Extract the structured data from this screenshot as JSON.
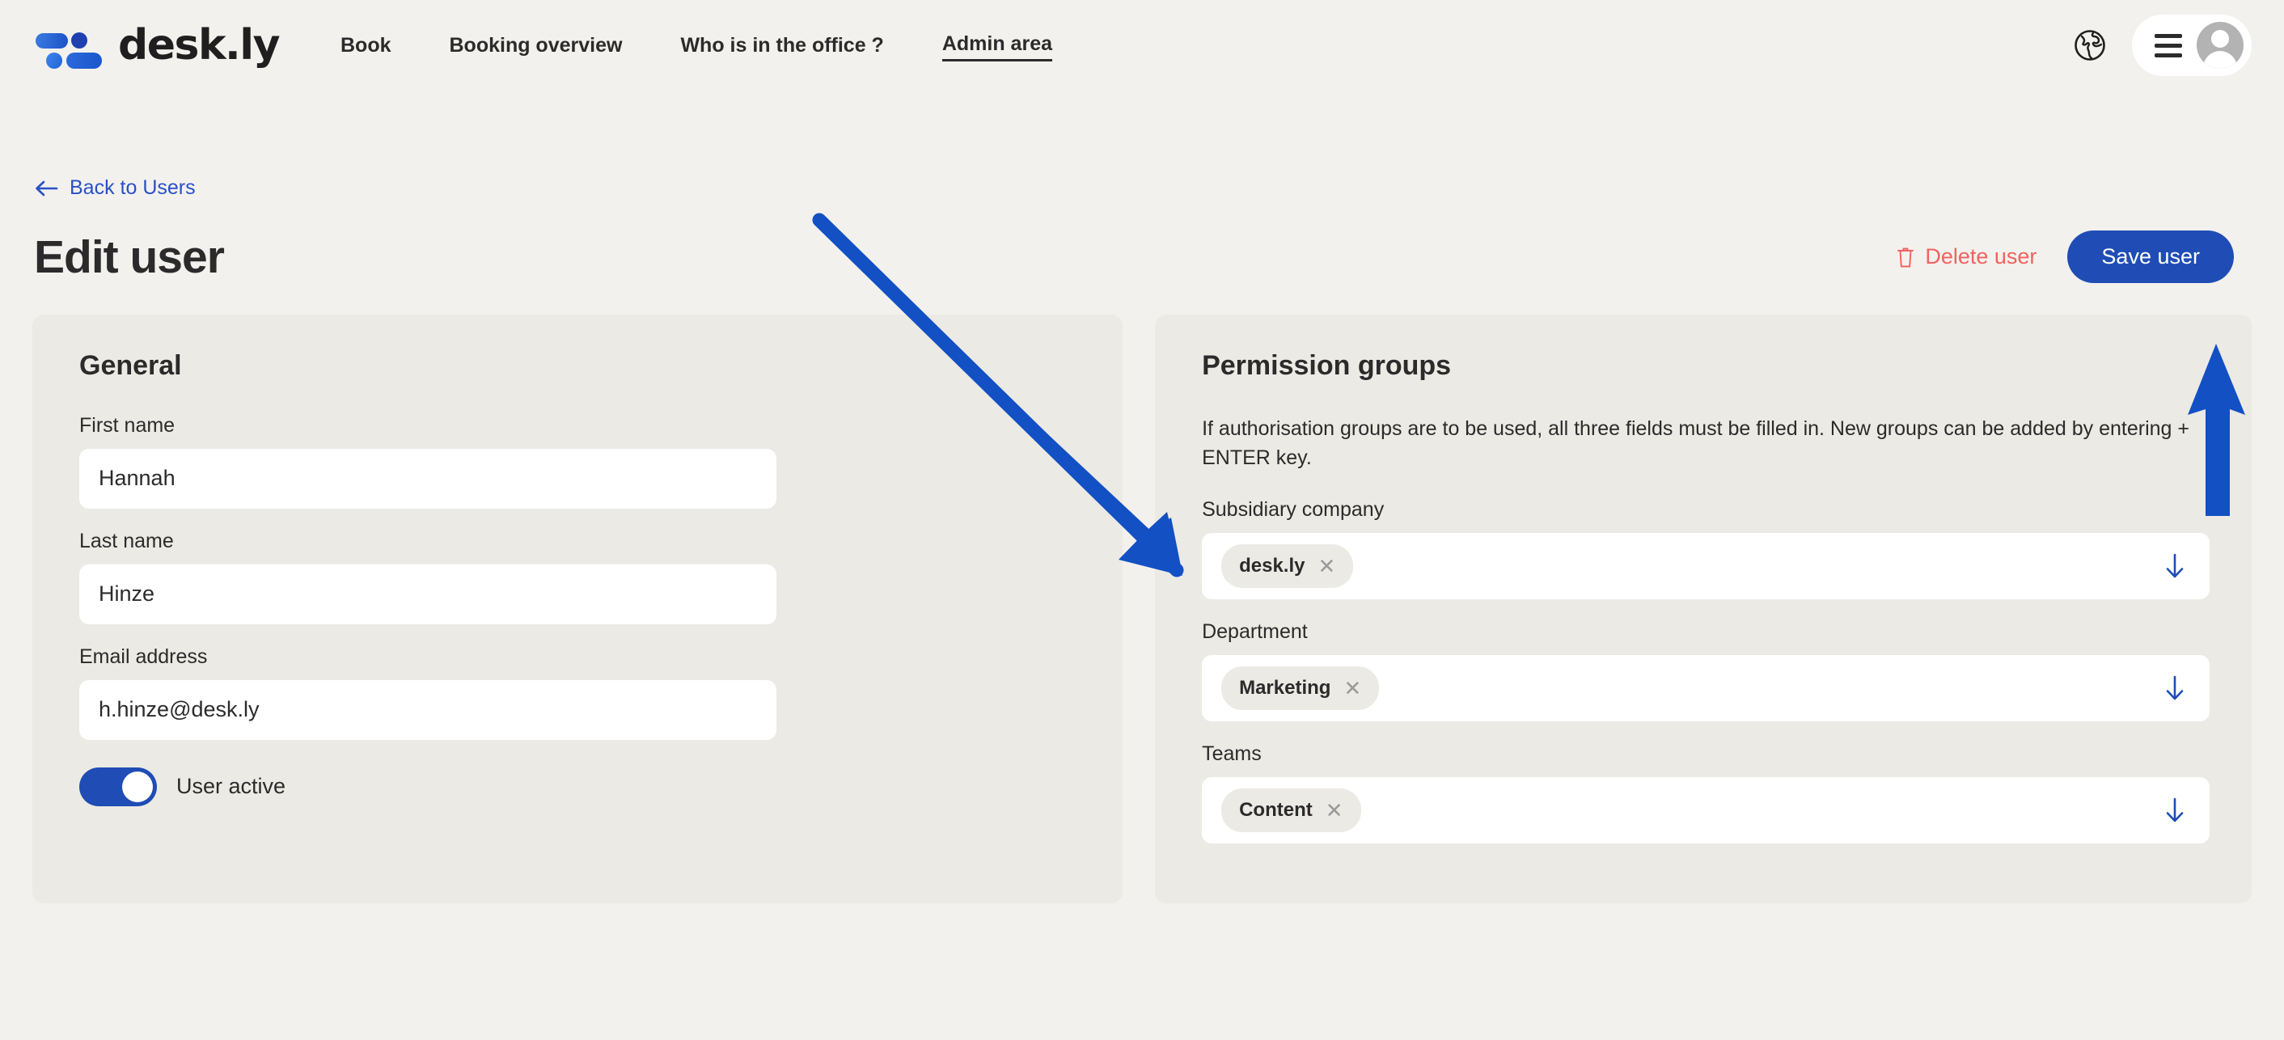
{
  "brand": {
    "name": "desk.ly",
    "logo_icon": "deskly-dots-logo"
  },
  "nav": {
    "items": [
      {
        "label": "Book",
        "active": false
      },
      {
        "label": "Booking overview",
        "active": false
      },
      {
        "label": "Who is in the office ?",
        "active": false
      },
      {
        "label": "Admin area",
        "active": true
      }
    ],
    "language_icon": "globe-icon",
    "menu_icon": "hamburger-menu-icon",
    "avatar_icon": "user-avatar-icon"
  },
  "back_link": {
    "label": "Back to Users",
    "icon": "arrow-left-icon"
  },
  "header": {
    "title": "Edit user",
    "delete_label": "Delete user",
    "delete_icon": "trash-icon",
    "save_label": "Save user"
  },
  "general": {
    "title": "General",
    "fields": [
      {
        "label": "First name",
        "value": "Hannah"
      },
      {
        "label": "Last name",
        "value": "Hinze"
      },
      {
        "label": "Email address",
        "value": "h.hinze@desk.ly"
      }
    ],
    "toggle": {
      "label": "User active",
      "on": true
    }
  },
  "permissions": {
    "title": "Permission groups",
    "description": "If authorisation groups are to be used, all three fields must be filled in. New groups can be added by entering + ENTER key.",
    "fields": [
      {
        "label": "Subsidiary company",
        "chip": "desk.ly",
        "remove_icon": "close-icon",
        "arrow_icon": "arrow-down-icon"
      },
      {
        "label": "Department",
        "chip": "Marketing",
        "remove_icon": "close-icon",
        "arrow_icon": "arrow-down-icon"
      },
      {
        "label": "Teams",
        "chip": "Content",
        "remove_icon": "close-icon",
        "arrow_icon": "arrow-down-icon"
      }
    ]
  },
  "annotations": {
    "arrow_diagonal": "points to Permission groups Subsidiary company field",
    "arrow_up": "points to Save user button"
  },
  "colors": {
    "page_background": "#f3f1ed",
    "panel_background": "#eceae4",
    "primary_blue": "#1f4db5",
    "link_blue": "#2950c8",
    "danger_red": "#f0625f",
    "annotation_blue": "#1250c4"
  }
}
